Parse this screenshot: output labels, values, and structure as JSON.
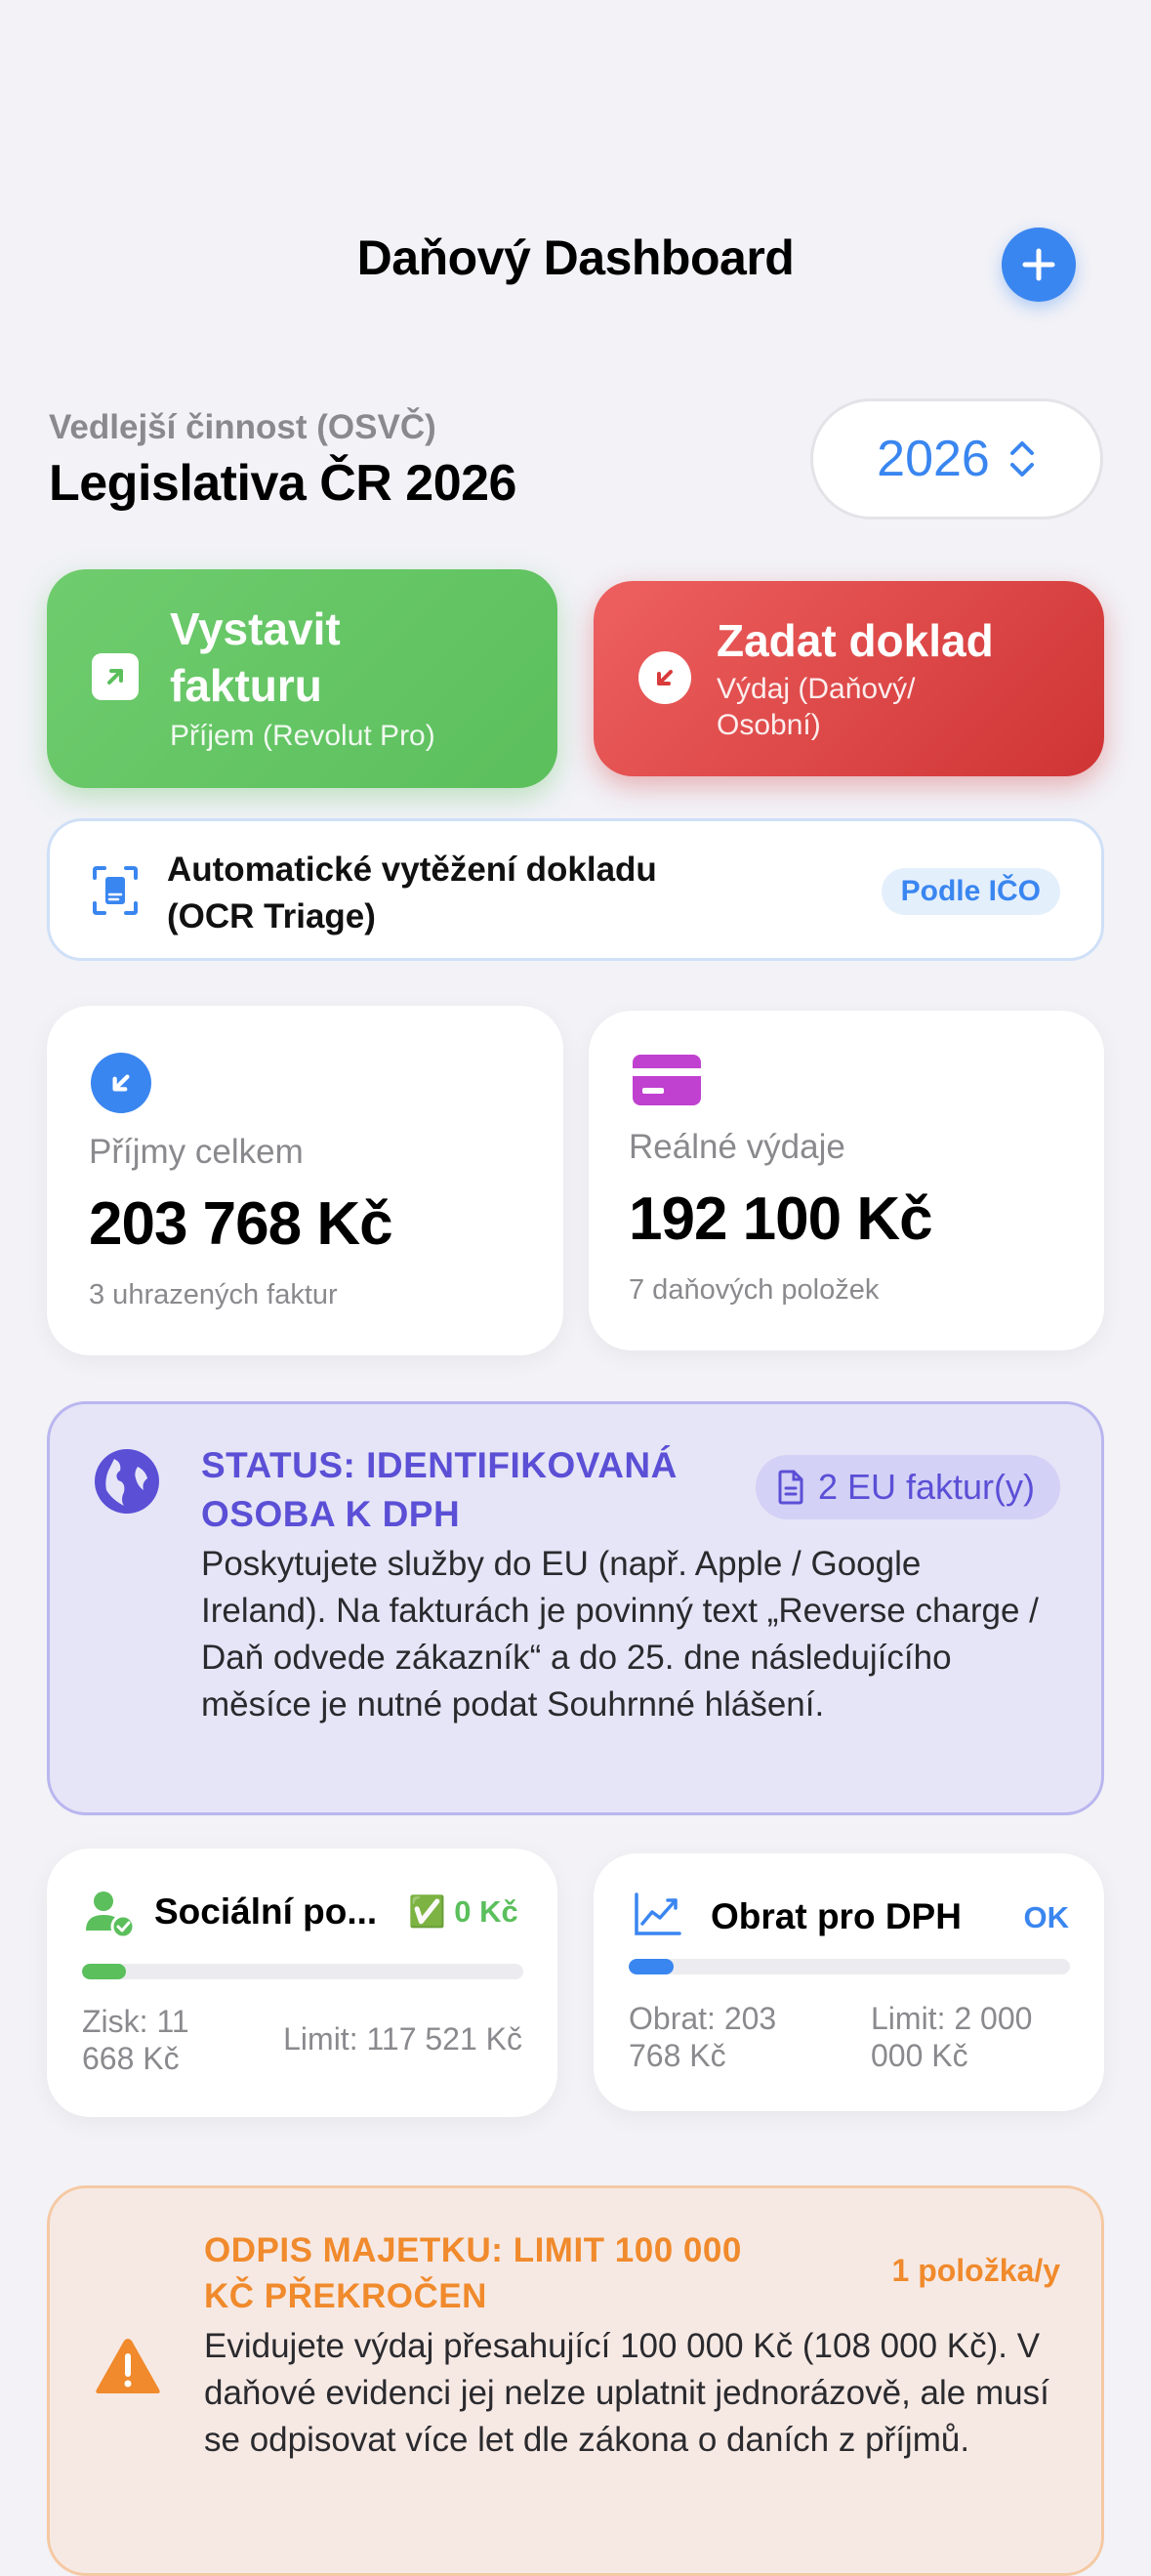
{
  "header": {
    "title": "Daňový Dashboard",
    "add_icon": "plus-icon"
  },
  "context": {
    "subtitle": "Vedlejší činnost (OSVČ)",
    "heading": "Legislativa ČR 2026",
    "year": "2026"
  },
  "actions": {
    "issue_invoice": {
      "title_line1": "Vystavit",
      "title_line2": "fakturu",
      "subtitle": "Příjem (Revolut Pro)",
      "color": "#5bbf5c"
    },
    "enter_document": {
      "title": "Zadat doklad",
      "subtitle_line1": "Výdaj (Daňový/",
      "subtitle_line2": "Osobní)",
      "color": "#d93b3b"
    }
  },
  "ocr": {
    "line1": "Automatické vytěžení dokladu",
    "line2": "(OCR Triage)",
    "badge": "Podle IČO"
  },
  "income": {
    "label": "Příjmy celkem",
    "value": "203 768 Kč",
    "note": "3 uhrazených faktur"
  },
  "expenses": {
    "label": "Reálné výdaje",
    "value": "192 100 Kč",
    "note": "7 daňových položek"
  },
  "vat_status": {
    "title_line1": "STATUS: IDENTIFIKOVANÁ",
    "title_line2": "OSOBA K DPH",
    "badge": "2 EU faktur(y)",
    "body": "Poskytujete služby do EU (např. Apple / Google Ireland). Na fakturách je povinný text „Reverse charge / Daň odvede zákazník“ a do 25. dne následujícího měsíce je nutné podat Souhrnné hlášení."
  },
  "social": {
    "title": "Sociální po...",
    "status_value": "✅ 0 Kč",
    "profit_line1": "Zisk: 11",
    "profit_line2": "668 Kč",
    "limit": "Limit: 117 521 Kč",
    "progress": 0.0993
  },
  "turnover": {
    "title": "Obrat pro DPH",
    "status": "OK",
    "turnover_line1": "Obrat: 203",
    "turnover_line2": "768 Kč",
    "limit_line1": "Limit: 2 000",
    "limit_line2": "000 Kč",
    "progress": 0.1019
  },
  "asset": {
    "title_line1": "ODPIS MAJETKU: LIMIT 100 000",
    "title_line2": "KČ PŘEKROČEN",
    "count": "1 položka/y",
    "body": "Evidujete výdaj přesahující 100 000 Kč (108 000 Kč). V daňové evidenci jej nelze uplatnit jednorázově, ale musí se odpisovat více let dle zákona o daních z příjmů."
  },
  "colors": {
    "accent": "#3a86f0",
    "purple": "#5b4fd6",
    "orange": "#f08a2c",
    "green": "#5bbf5c",
    "red": "#d93b3b",
    "magenta": "#c040d0"
  }
}
